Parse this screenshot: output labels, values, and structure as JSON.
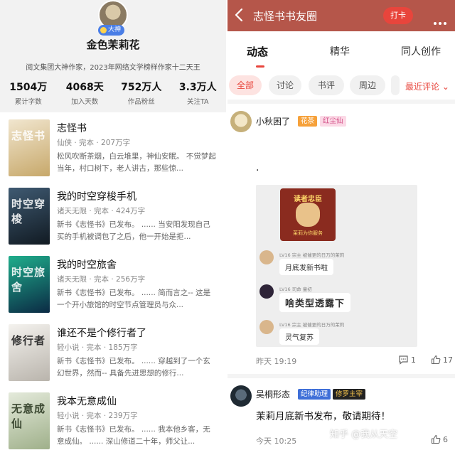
{
  "profile": {
    "badge": "大神",
    "name": "金色茉莉花",
    "desc": "阅文集团大神作家，2023年网络文学榜样作家十二天王",
    "stats": [
      {
        "value": "1504万",
        "label": "累计字数"
      },
      {
        "value": "4068天",
        "label": "加入天数"
      },
      {
        "value": "752万人",
        "label": "作品粉丝"
      },
      {
        "value": "3.3万人",
        "label": "关注TA"
      }
    ]
  },
  "books": [
    {
      "title": "志怪书",
      "meta": "仙侠 · 完本 · 207万字",
      "desc": "松风吹断茶烟，白云堆里，神仙安眠。 不觉梦起当年，村口树下，老人讲古，那些惊...",
      "cover": "志怪书",
      "colors": [
        "#f1e6cf",
        "#c7a86a"
      ]
    },
    {
      "title": "我的时空穿梭手机",
      "meta": "诸天无限 · 完本 · 424万字",
      "desc": "新书《志怪书》已发布。 ...... 当安阳发现自己买的手机被调包了之后，他一开始是拒...",
      "cover": "时空穿梭",
      "colors": [
        "#3f5a72",
        "#111a22"
      ]
    },
    {
      "title": "我的时空旅舍",
      "meta": "诸天无限 · 完本 · 256万字",
      "desc": "新书《志怪书》已发布。 ...... 简而言之-- 这是一个开小旅馆的时空节点管理员与众...",
      "cover": "时空旅舍",
      "colors": [
        "#1fae8c",
        "#0b2a44"
      ]
    },
    {
      "title": "谁还不是个修行者了",
      "meta": "轻小说 · 完本 · 185万字",
      "desc": "新书《志怪书》已发布。 ...... 穿越到了一个玄幻世界，然而-- 具备先进思想的修行...",
      "cover": "修行者",
      "colors": [
        "#f4f2ee",
        "#b9b4ac"
      ]
    },
    {
      "title": "我本无意成仙",
      "meta": "轻小说 · 完本 · 239万字",
      "desc": "新书《志怪书》已发布。 ...... 我本他乡客，无意成仙。 ...... 深山修道二十年，师父让...",
      "cover": "无意成仙",
      "colors": [
        "#e4eadb",
        "#9fb08a"
      ]
    }
  ],
  "circle": {
    "title": "志怪书书友圈",
    "checkin": "打卡",
    "tabs": [
      "动态",
      "精华",
      "同人创作"
    ],
    "chips": [
      "全部",
      "讨论",
      "书评",
      "周边"
    ],
    "sort": "最近评论",
    "post1": {
      "user": "小秋困了",
      "tags": [
        "花茶",
        "红尘仙"
      ],
      "content": ".",
      "card_title": "读者忠臣",
      "card_foot": "茉莉为你服务",
      "chat": [
        {
          "meta": "LV16 宗主 被催更的日万的茉莉",
          "text": "月底发新书啦"
        },
        {
          "meta": "LV16 司命 童初",
          "text": "啥类型透露下"
        },
        {
          "meta": "LV16 宗主 被催更的日万的茉莉",
          "text": "灵气复苏"
        }
      ],
      "time": "昨天 19:19",
      "comments": "1",
      "likes": "17"
    },
    "post2": {
      "user": "吴桐形态",
      "tags": [
        "纪律助理",
        "修罗主宰"
      ],
      "content": "茉莉月底新书发布，敬请期待！",
      "time": "今天 10:25",
      "likes": "6"
    },
    "watermark": "知乎 @我从天空"
  }
}
